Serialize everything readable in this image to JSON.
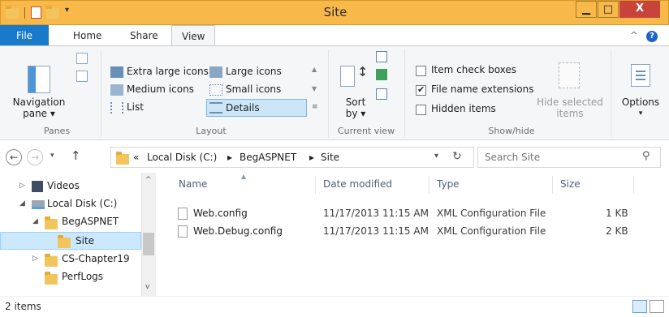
{
  "window": {
    "title": "Site",
    "minimize_label": "▁",
    "maximize_label": "□",
    "close_label": "X"
  },
  "tabs": [
    {
      "label": "File"
    },
    {
      "label": "Home"
    },
    {
      "label": "Share"
    },
    {
      "label": "View"
    }
  ],
  "ribbon": {
    "panes": {
      "label": "Panes",
      "navigation_pane_line1": "Navigation",
      "navigation_pane_line2": "pane ▾"
    },
    "layout": {
      "label": "Layout",
      "items": [
        {
          "label": "Extra large icons"
        },
        {
          "label": "Large icons"
        },
        {
          "label": "Medium icons"
        },
        {
          "label": "Small icons"
        },
        {
          "label": "List"
        },
        {
          "label": "Details"
        }
      ]
    },
    "current_view": {
      "label": "Current view",
      "sort_line1": "Sort",
      "sort_line2": "by ▾"
    },
    "show_hide": {
      "label": "Show/hide",
      "item_check_boxes": "Item check boxes",
      "file_name_extensions": "File name extensions",
      "hidden_items": "Hidden items",
      "hide_selected_line1": "Hide selected",
      "hide_selected_line2": "items"
    },
    "options": {
      "label": "Options"
    }
  },
  "address": {
    "separator": "«",
    "crumbs": [
      "Local Disk (C:)",
      "BegASPNET",
      "Site"
    ],
    "arrow": "▸"
  },
  "search": {
    "placeholder": "Search Site"
  },
  "nav_tree": [
    {
      "label": "Videos"
    },
    {
      "label": "Local Disk (C:)"
    },
    {
      "label": "BegASPNET"
    },
    {
      "label": "Site"
    },
    {
      "label": "CS-Chapter19"
    },
    {
      "label": "PerfLogs"
    }
  ],
  "columns": {
    "name": "Name",
    "date_modified": "Date modified",
    "type": "Type",
    "size": "Size"
  },
  "files": [
    {
      "name": "Web.config",
      "date_modified": "11/17/2013 11:15 AM",
      "type": "XML Configuration File",
      "size": "1 KB"
    },
    {
      "name": "Web.Debug.config",
      "date_modified": "11/17/2013 11:15 AM",
      "type": "XML Configuration File",
      "size": "2 KB"
    }
  ],
  "status": {
    "item_count": "2 items"
  },
  "colors": {
    "title_bar": "#f8b94a",
    "file_tab": "#1979ca",
    "close_button": "#c8433a",
    "selection": "#cce8ff"
  }
}
